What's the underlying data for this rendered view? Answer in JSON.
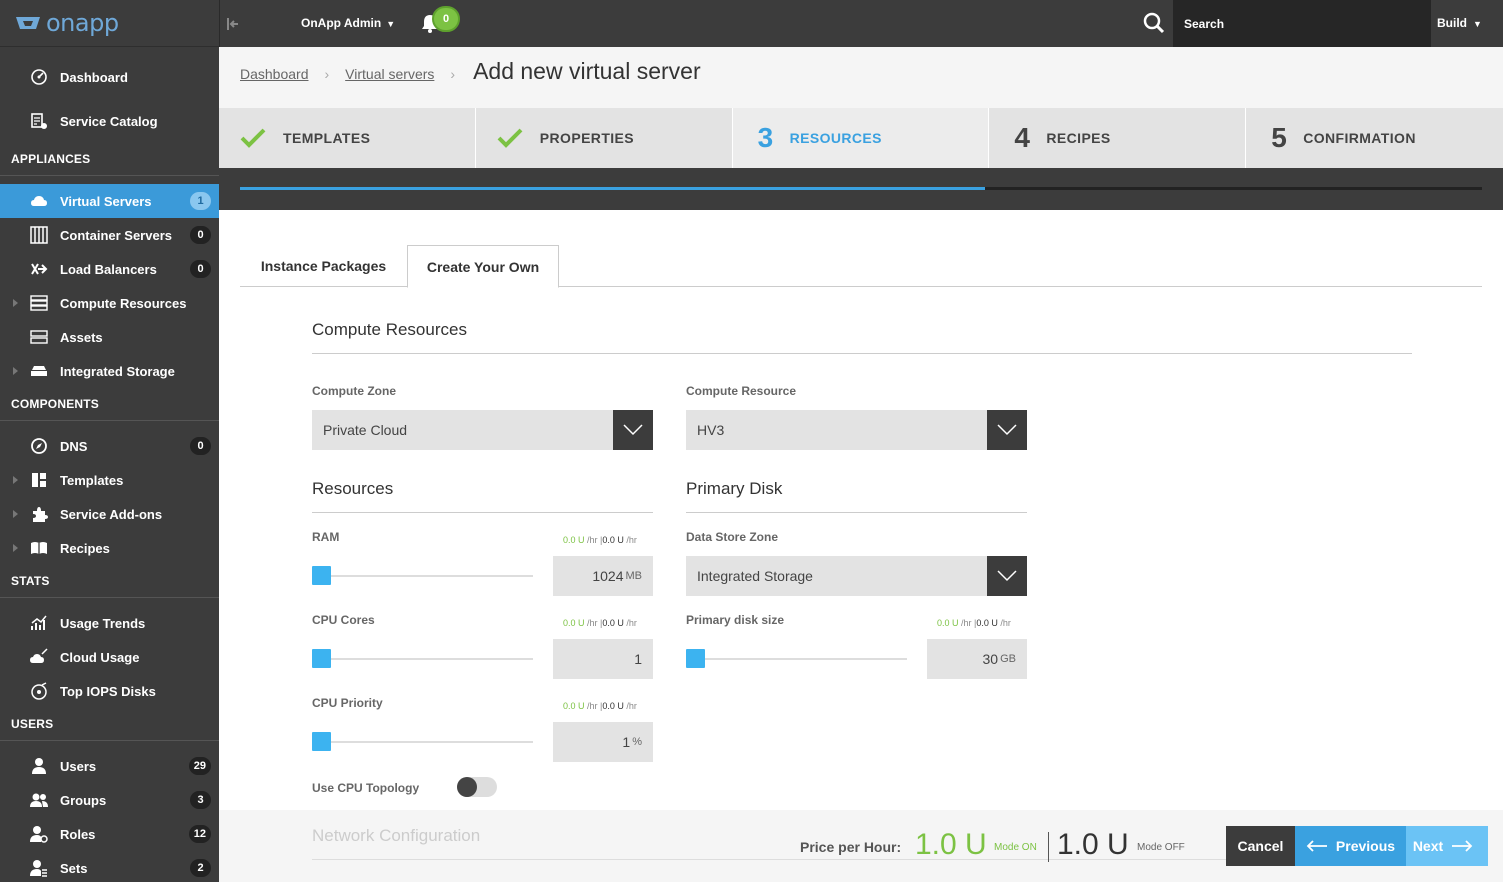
{
  "app": {
    "logo": "onapp"
  },
  "topbar": {
    "user": "OnApp Admin",
    "notifications": "0",
    "search_placeholder": "Search",
    "build": "Build"
  },
  "sidebar": {
    "top_items": [
      {
        "label": "Dashboard",
        "icon": "dashboard-icon"
      },
      {
        "label": "Service Catalog",
        "icon": "service-catalog-icon"
      }
    ],
    "sections": [
      {
        "title": "APPLIANCES",
        "items": [
          {
            "label": "Virtual Servers",
            "badge": "1",
            "active": true,
            "icon": "cloud-icon"
          },
          {
            "label": "Container Servers",
            "badge": "0",
            "icon": "container-icon"
          },
          {
            "label": "Load Balancers",
            "badge": "0",
            "icon": "load-balancer-icon"
          },
          {
            "label": "Compute Resources",
            "icon": "server-icon",
            "expandable": true
          },
          {
            "label": "Assets",
            "icon": "assets-icon"
          },
          {
            "label": "Integrated Storage",
            "icon": "storage-icon",
            "expandable": true
          }
        ]
      },
      {
        "title": "COMPONENTS",
        "items": [
          {
            "label": "DNS",
            "badge": "0",
            "icon": "dns-icon"
          },
          {
            "label": "Templates",
            "icon": "templates-icon",
            "expandable": true
          },
          {
            "label": "Service Add-ons",
            "icon": "puzzle-icon",
            "expandable": true
          },
          {
            "label": "Recipes",
            "icon": "recipes-icon",
            "expandable": true
          }
        ]
      },
      {
        "title": "STATS",
        "items": [
          {
            "label": "Usage Trends",
            "icon": "trends-icon"
          },
          {
            "label": "Cloud Usage",
            "icon": "cloud-usage-icon"
          },
          {
            "label": "Top IOPS Disks",
            "icon": "iops-icon"
          }
        ]
      },
      {
        "title": "USERS",
        "items": [
          {
            "label": "Users",
            "badge": "29",
            "icon": "user-icon"
          },
          {
            "label": "Groups",
            "badge": "3",
            "icon": "group-icon"
          },
          {
            "label": "Roles",
            "badge": "12",
            "icon": "roles-icon"
          },
          {
            "label": "Sets",
            "badge": "2",
            "icon": "sets-icon"
          }
        ]
      }
    ]
  },
  "breadcrumb": {
    "items": [
      "Dashboard",
      "Virtual servers"
    ],
    "title": "Add new virtual server"
  },
  "steps": [
    {
      "label": "TEMPLATES",
      "done": true
    },
    {
      "label": "PROPERTIES",
      "done": true
    },
    {
      "num": "3",
      "label": "RESOURCES",
      "active": true
    },
    {
      "num": "4",
      "label": "RECIPES"
    },
    {
      "num": "5",
      "label": "CONFIRMATION"
    }
  ],
  "wizard_progress": 0.6,
  "tabs": {
    "instance_packages": "Instance Packages",
    "create_your_own": "Create Your Own"
  },
  "compute": {
    "title": "Compute Resources",
    "zone_label": "Compute Zone",
    "zone_value": "Private Cloud",
    "resource_label": "Compute Resource",
    "resource_value": "HV3"
  },
  "resources": {
    "title": "Resources",
    "ram": {
      "label": "RAM",
      "value": "1024",
      "unit": "MB",
      "on": "0.0 U",
      "off": "0.0 U",
      "per": "/hr"
    },
    "cpu_cores": {
      "label": "CPU Cores",
      "value": "1",
      "unit": "",
      "on": "0.0 U",
      "off": "0.0 U",
      "per": "/hr"
    },
    "cpu_priority": {
      "label": "CPU Priority",
      "value": "1",
      "unit": "%",
      "on": "0.0 U",
      "off": "0.0 U",
      "per": "/hr"
    },
    "topology_label": "Use CPU Topology"
  },
  "primary_disk": {
    "title": "Primary Disk",
    "zone_label": "Data Store Zone",
    "zone_value": "Integrated Storage",
    "size": {
      "label": "Primary disk size",
      "value": "30",
      "unit": "GB",
      "on": "0.0 U",
      "off": "0.0 U",
      "per": "/hr"
    }
  },
  "footer": {
    "network_title": "Network Configuration",
    "price_label": "Price per Hour:",
    "price_on": "1.0 U",
    "mode_on": "Mode ON",
    "price_off": "1.0 U",
    "mode_off": "Mode OFF",
    "cancel": "Cancel",
    "previous": "Previous",
    "next": "Next"
  },
  "colors": {
    "accent": "#3aa1e0",
    "green": "#7cc243",
    "sidebar": "#3c3c3c"
  }
}
